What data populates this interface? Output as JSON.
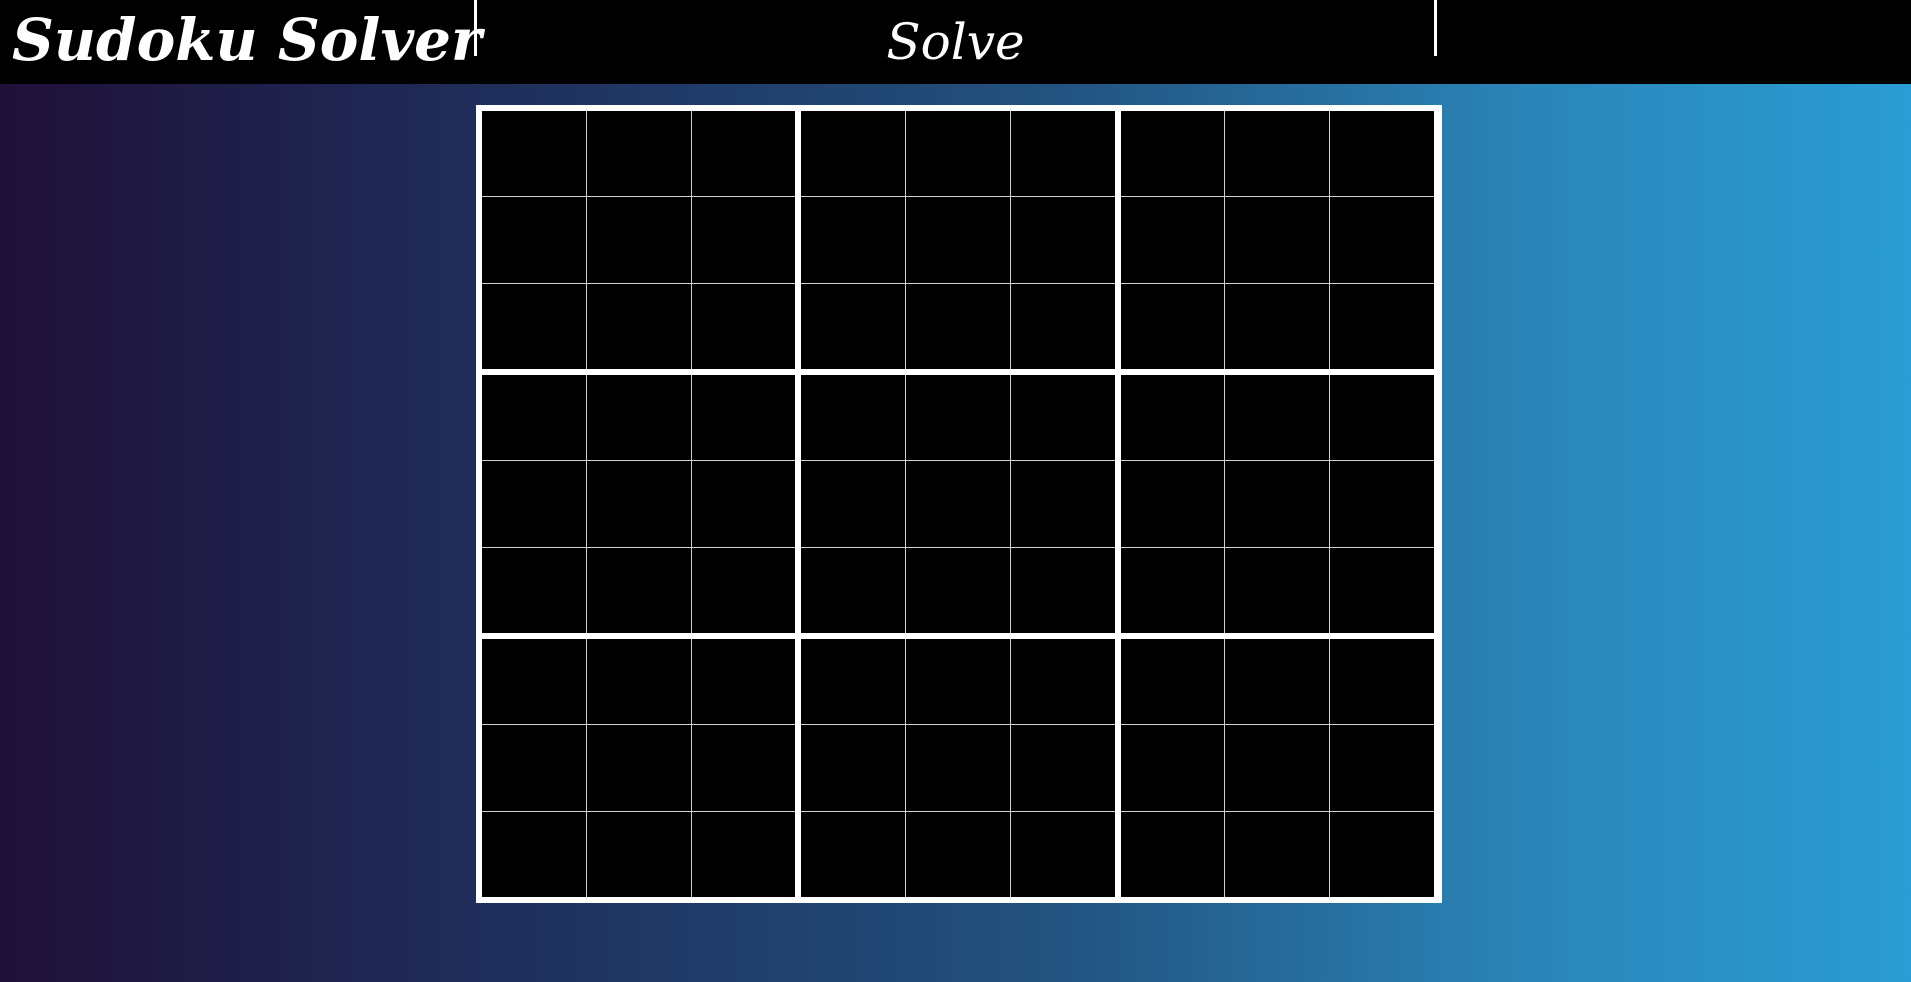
{
  "header": {
    "title": "Sudoku Solver",
    "solve_label": "Solve"
  },
  "colors": {
    "header_background": "#000000",
    "cell_background": "#000000",
    "grid_lines": "#ffffff",
    "gradient_start": "#1f1038",
    "gradient_end": "#2a9dd4"
  },
  "board": {
    "size": 9,
    "box_size": 3,
    "cells": [
      [
        "",
        "",
        "",
        "",
        "",
        "",
        "",
        "",
        ""
      ],
      [
        "",
        "",
        "",
        "",
        "",
        "",
        "",
        "",
        ""
      ],
      [
        "",
        "",
        "",
        "",
        "",
        "",
        "",
        "",
        ""
      ],
      [
        "",
        "",
        "",
        "",
        "",
        "",
        "",
        "",
        ""
      ],
      [
        "",
        "",
        "",
        "",
        "",
        "",
        "",
        "",
        ""
      ],
      [
        "",
        "",
        "",
        "",
        "",
        "",
        "",
        "",
        ""
      ],
      [
        "",
        "",
        "",
        "",
        "",
        "",
        "",
        "",
        ""
      ],
      [
        "",
        "",
        "",
        "",
        "",
        "",
        "",
        "",
        ""
      ],
      [
        "",
        "",
        "",
        "",
        "",
        "",
        "",
        "",
        ""
      ]
    ]
  }
}
